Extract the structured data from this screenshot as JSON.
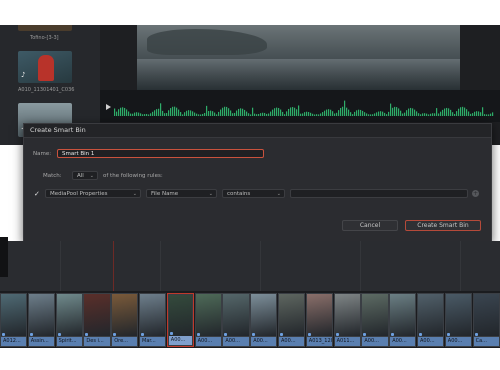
{
  "media": {
    "clips": [
      {
        "label": "Tofino-[3-3]"
      },
      {
        "label": "A010_11301401_C036"
      }
    ]
  },
  "dialog": {
    "title": "Create Smart Bin",
    "name_label": "Name:",
    "name_value": "Smart Bin 1",
    "match_label": "Match:",
    "match_value": "All",
    "rules_suffix": "of the following rules:",
    "rule": {
      "enabled": true,
      "category": "MediaPool Properties",
      "field": "File Name",
      "operator": "contains",
      "value": ""
    },
    "cancel_label": "Cancel",
    "create_label": "Create Smart Bin"
  },
  "strip": {
    "clips": [
      {
        "name": "A012...",
        "color": "#4f6a74"
      },
      {
        "name": "Assin...",
        "color": "#6d7e8a"
      },
      {
        "name": "Spirit...",
        "color": "#708a8c"
      },
      {
        "name": "Des i...",
        "color": "#5a2f2a"
      },
      {
        "name": "Ore...",
        "color": "#7a5a3a"
      },
      {
        "name": "Mar...",
        "color": "#6e7f8c"
      },
      {
        "name": "A00...",
        "color": "#344a3c",
        "selected": true
      },
      {
        "name": "A00...",
        "color": "#4e6a58"
      },
      {
        "name": "A00...",
        "color": "#55676a"
      },
      {
        "name": "A00...",
        "color": "#7d8f9a"
      },
      {
        "name": "A00...",
        "color": "#5e6660"
      },
      {
        "name": "A013_120...",
        "color": "#8a6f6a"
      },
      {
        "name": "A011...",
        "color": "#7f8586"
      },
      {
        "name": "A00...",
        "color": "#5d6b64"
      },
      {
        "name": "A00...",
        "color": "#6b7f84"
      },
      {
        "name": "A00...",
        "color": "#51606a"
      },
      {
        "name": "A00...",
        "color": "#4a5a66"
      },
      {
        "name": "Ca...",
        "color": "#3a4550"
      }
    ]
  }
}
